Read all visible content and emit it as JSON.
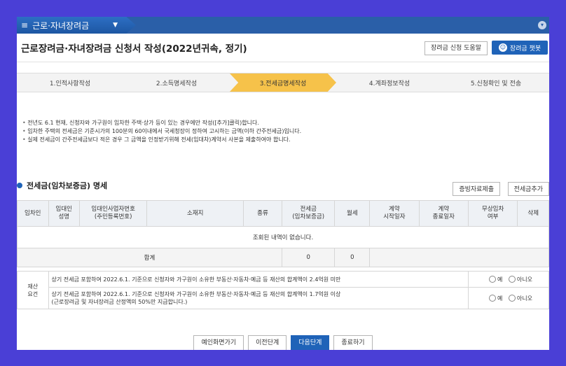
{
  "menu": {
    "label": "근로·자녀장려금"
  },
  "page_title": "근로장려금·자녀장려금 신청서 작성(2022년귀속, 정기)",
  "buttons": {
    "help": "장려금 신청 도움말",
    "chat": "장려금 챗봇"
  },
  "steps": [
    {
      "label": "1.인적사항작성",
      "active": false
    },
    {
      "label": "2.소득명세작성",
      "active": false
    },
    {
      "label": "3.전세금명세작성",
      "active": true
    },
    {
      "label": "4.계좌정보작성",
      "active": false
    },
    {
      "label": "5.신청확인 및 전송",
      "active": false
    }
  ],
  "notes": [
    "전년도 6.1 현재, 신청자와 가구원이 임차한 주택·상가 등이 있는 경우에만 작성([추가]클릭)합니다.",
    "임차한 주택의 전세금은 기준시가의 100분의 60이내에서 국세청장이 정하여 고시하는 금액(이하 간주전세금)입니다.",
    "실제 전세금이 간주전세금보다 적은 경우 그 금액을 인정받기위해 전세(임대차)계약서 사본을 제출하여야 합니다."
  ],
  "section": {
    "title": "전세금(임차보증금) 명세",
    "btn_proof": "증빙자료제출",
    "btn_add": "전세금추가"
  },
  "table": {
    "headers": [
      "임차인",
      "임대인\n성명",
      "임대인사업자번호\n(주민등록번호)",
      "소재지",
      "종류",
      "전세금\n(임차보증금)",
      "월세",
      "계약\n시작일자",
      "계약\n종료일자",
      "무상임차\n여부",
      "삭제"
    ],
    "empty_msg": "조회된 내역이 없습니다.",
    "sum_label": "합계",
    "sum_deposit": "0",
    "sum_rent": "0"
  },
  "requirements": {
    "label": "재산\n요건",
    "rows": [
      {
        "text": "상기 전세금 포함하여 2022.6.1. 기준으로 신청자와 가구원이 소유한 부동산·자동차·예금 등 재산의 합계액이 2.4억원 미만",
        "yes": "예",
        "no": "아니오"
      },
      {
        "text": "상기 전세금 포함하여 2022.6.1. 기준으로 신청자와 가구원이 소유한 부동산·자동차·예금 등 재산의 합계액이 1.7억원 이상\n(근로장려금 및 자녀장려금 산정액의 50%만 지급합니다.)",
        "yes": "예",
        "no": "아니오"
      }
    ]
  },
  "bottom": {
    "print": "예인화면가기",
    "prev": "이전단계",
    "next": "다음단계",
    "exit": "종료하기"
  }
}
